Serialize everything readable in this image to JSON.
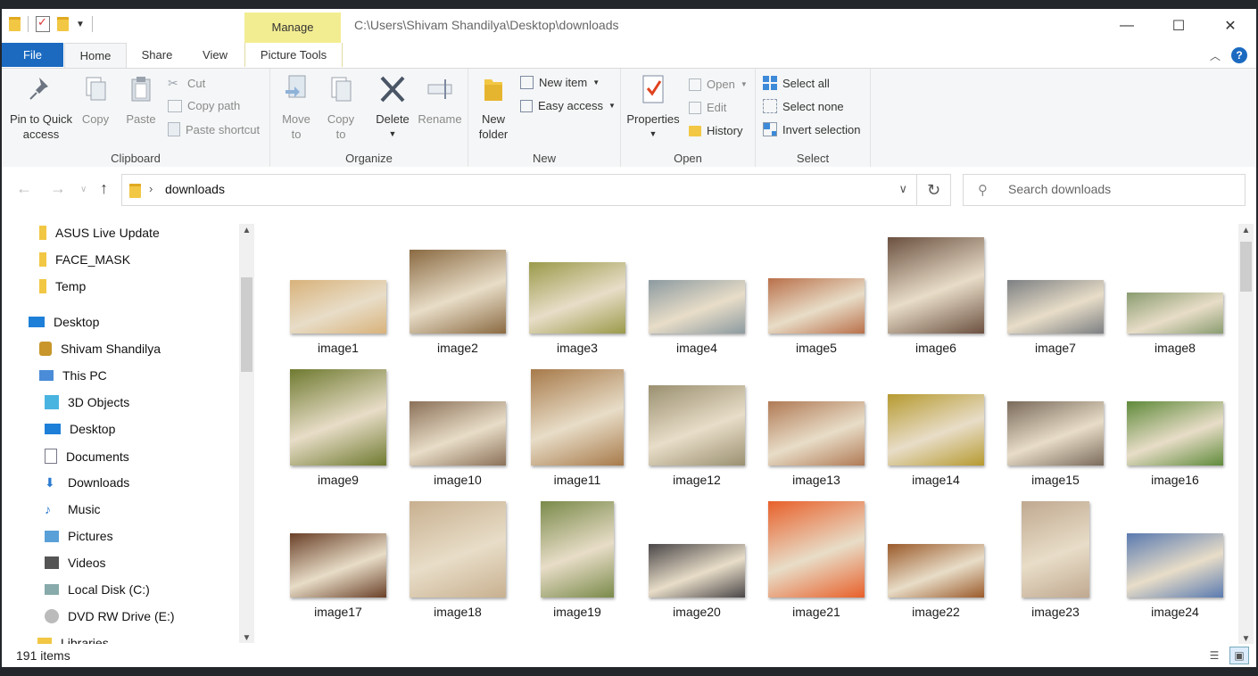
{
  "window": {
    "path_title": "C:\\Users\\Shivam Shandilya\\Desktop\\downloads",
    "manage_label": "Manage",
    "minimize_glyph": "—",
    "maximize_glyph": "☐",
    "close_glyph": "✕"
  },
  "tabs": {
    "file": "File",
    "home": "Home",
    "share": "Share",
    "view": "View",
    "picture_tools": "Picture Tools"
  },
  "ribbon": {
    "clipboard": {
      "label": "Clipboard",
      "pin_line1": "Pin to Quick",
      "pin_line2": "access",
      "copy": "Copy",
      "paste": "Paste",
      "cut": "Cut",
      "copy_path": "Copy path",
      "paste_shortcut": "Paste shortcut"
    },
    "organize": {
      "label": "Organize",
      "move_line1": "Move",
      "move_line2": "to",
      "copy_line1": "Copy",
      "copy_line2": "to",
      "delete": "Delete",
      "rename": "Rename"
    },
    "new": {
      "label": "New",
      "folder_line1": "New",
      "folder_line2": "folder",
      "new_item": "New item",
      "easy_access": "Easy access"
    },
    "open": {
      "label": "Open",
      "properties": "Properties",
      "open": "Open",
      "edit": "Edit",
      "history": "History"
    },
    "select": {
      "label": "Select",
      "select_all": "Select all",
      "select_none": "Select none",
      "invert_selection": "Invert selection"
    }
  },
  "address": {
    "crumb": "downloads",
    "search_placeholder": "Search downloads"
  },
  "nav": {
    "items": [
      {
        "label": "ASUS Live Update",
        "icon": "folder-icon"
      },
      {
        "label": "FACE_MASK",
        "icon": "folder-icon"
      },
      {
        "label": "Temp",
        "icon": "folder-icon"
      },
      {
        "label": "Desktop",
        "icon": "desktop-icon"
      },
      {
        "label": "Shivam Shandilya",
        "icon": "user-icon"
      },
      {
        "label": "This PC",
        "icon": "computer-icon"
      },
      {
        "label": "3D Objects",
        "icon": "cube-icon"
      },
      {
        "label": "Desktop",
        "icon": "desktop-icon"
      },
      {
        "label": "Documents",
        "icon": "document-icon"
      },
      {
        "label": "Downloads",
        "icon": "download-arrow-icon"
      },
      {
        "label": "Music",
        "icon": "music-note-icon"
      },
      {
        "label": "Pictures",
        "icon": "pictures-icon"
      },
      {
        "label": "Videos",
        "icon": "film-icon"
      },
      {
        "label": "Local Disk (C:)",
        "icon": "drive-icon"
      },
      {
        "label": "DVD RW Drive (E:)",
        "icon": "dvd-icon"
      },
      {
        "label": "Libraries",
        "icon": "library-icon"
      }
    ]
  },
  "files": [
    {
      "name": "image1",
      "color": "#d8b27a"
    },
    {
      "name": "image2",
      "color": "#8a6a42"
    },
    {
      "name": "image3",
      "color": "#9a9a4a"
    },
    {
      "name": "image4",
      "color": "#8c9aa0"
    },
    {
      "name": "image5",
      "color": "#b9704a"
    },
    {
      "name": "image6",
      "color": "#6b5040"
    },
    {
      "name": "image7",
      "color": "#7c7f82"
    },
    {
      "name": "image8",
      "color": "#8a9c70"
    },
    {
      "name": "image9",
      "color": "#6f7a30"
    },
    {
      "name": "image10",
      "color": "#8b7058"
    },
    {
      "name": "image11",
      "color": "#a77a4a"
    },
    {
      "name": "image12",
      "color": "#9a9070"
    },
    {
      "name": "image13",
      "color": "#b07a55"
    },
    {
      "name": "image14",
      "color": "#b69a30"
    },
    {
      "name": "image15",
      "color": "#7a6a5a"
    },
    {
      "name": "image16",
      "color": "#5f8a3a"
    },
    {
      "name": "image17",
      "color": "#6a4028"
    },
    {
      "name": "image18",
      "color": "#c8b090"
    },
    {
      "name": "image19",
      "color": "#7a8a4a"
    },
    {
      "name": "image20",
      "color": "#4a4648"
    },
    {
      "name": "image21",
      "color": "#e8602a"
    },
    {
      "name": "image22",
      "color": "#9a5a2a"
    },
    {
      "name": "image23",
      "color": "#c0a890"
    },
    {
      "name": "image24",
      "color": "#5a7ab0"
    }
  ],
  "status": {
    "count": "191 items"
  },
  "colors": {
    "accent": "#1b6ac0",
    "manage_tab": "#f3ed92",
    "folder": "#f2c744"
  }
}
